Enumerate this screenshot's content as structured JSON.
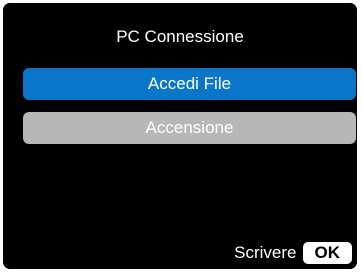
{
  "screen": {
    "title": "PC Connessione"
  },
  "menu": {
    "items": [
      {
        "label": "Accedi File",
        "selected": true
      },
      {
        "label": "Accensione",
        "selected": false
      }
    ]
  },
  "footer": {
    "action_label": "Scrivere",
    "key_label": "OK"
  },
  "colors": {
    "background": "#000000",
    "selected": "#0a76c9",
    "unselected": "#b7b7b7",
    "text": "#ffffff"
  }
}
